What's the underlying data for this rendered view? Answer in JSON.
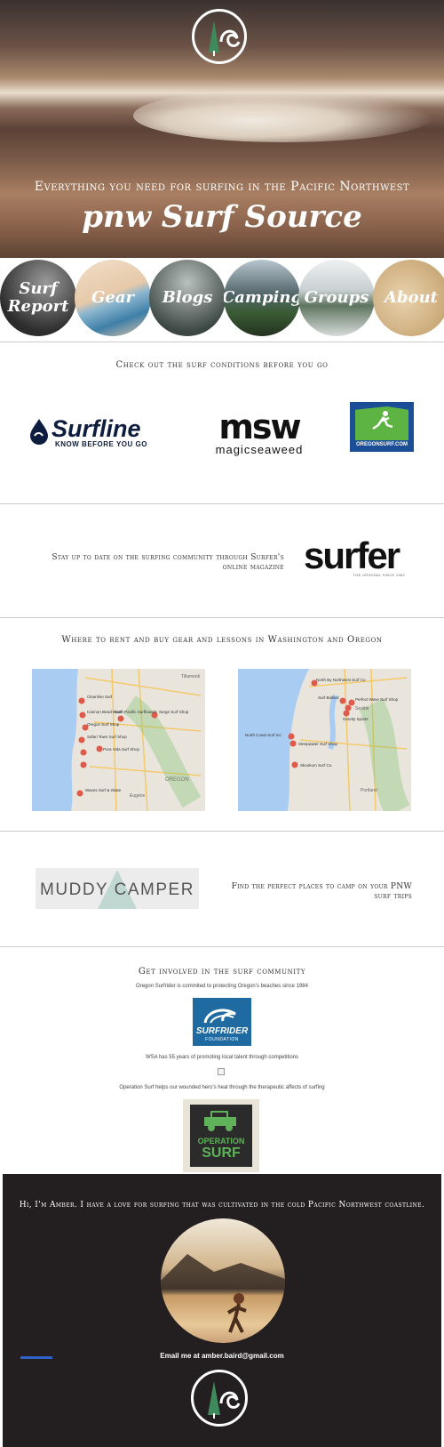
{
  "hero": {
    "tagline": "Everything you need for surfing in the Pacific Northwest",
    "brand": "pnw Surf Source",
    "logo_icon": "tree-wave-logo-icon"
  },
  "nav": {
    "items": [
      {
        "label": "Surf Report",
        "bg": "#4a4a4a"
      },
      {
        "label": "Gear",
        "bg": "#d9c1a5"
      },
      {
        "label": "Blogs",
        "bg": "#5c6660"
      },
      {
        "label": "Camping",
        "bg": "#5d6f68"
      },
      {
        "label": "Groups",
        "bg": "#b7c1c3"
      },
      {
        "label": "About",
        "bg": "#d8bc93"
      }
    ]
  },
  "surf_conditions": {
    "heading": "Check out the surf conditions before you go",
    "surfline": {
      "name": "Surfline",
      "tag": "KNOW BEFORE YOU GO"
    },
    "msw": {
      "name": "msw",
      "sub": "magicseaweed"
    },
    "oregonsurf": {
      "label": "OREGONSURF.COM",
      "color": "#1b4e97"
    }
  },
  "magazine": {
    "text": "Stay up to date on the surfing community through Surfer's online magazine",
    "logo": "surfer",
    "logo_sub": "THE ORIGINAL SINCE 1962"
  },
  "gear": {
    "heading": "Where to rent and buy gear and lessons in Washington and Oregon",
    "map_oregon": {
      "pins": [
        "Cleanline Surf",
        "Cleanline Surf Shop",
        "Cannon Beach Surf",
        "North Pacific Surfboards",
        "Surge Surf Shop",
        "Oregon Surf Shop",
        "Safari Town Surf Shop",
        "Pura Vida Surf Shop",
        "Ossies Surf Shop",
        "Waves Surf & Skate"
      ],
      "labels": [
        "Tillamook",
        "Salem",
        "Eugene",
        "OREGON"
      ]
    },
    "map_washington": {
      "pins": [
        "North By Northwest Surf Co",
        "Surf Ballard",
        "Perfect Wave Surf Shop",
        "Gravity Sports",
        "North Coast Surf Inc",
        "Steepwater Surf Shop",
        "Skookum Surf Co."
      ],
      "labels": [
        "Seattle",
        "Tacoma",
        "Olympia",
        "Portland"
      ]
    }
  },
  "camping": {
    "logo": "MUDDY CAMPER",
    "text": "Find the perfect places to camp on your PNW surf trips"
  },
  "community": {
    "heading": "Get involved in the surf community",
    "surfrider_text": "Oregon Surfrider is commited to protecting Oregon's beaches since 1984",
    "surfrider_logo": "SURFRIDER",
    "surfrider_sub": "FOUNDATION",
    "wsa_text": "WSA has 55 years of promoting local talent through competitions",
    "opsurf_text": "Operation Surf helps our wounded hero's heal through the therapeutic affects of surfing",
    "opsurf_logo_1": "OPERATION",
    "opsurf_logo_2": "SURF"
  },
  "footer": {
    "intro": "Hi, I'm Amber. I have a love for surfing that was cultivated in the cold Pacific Northwest coastline.",
    "email": "Email me at amber.baird@gmail.com",
    "accent": "#2f62c9"
  }
}
